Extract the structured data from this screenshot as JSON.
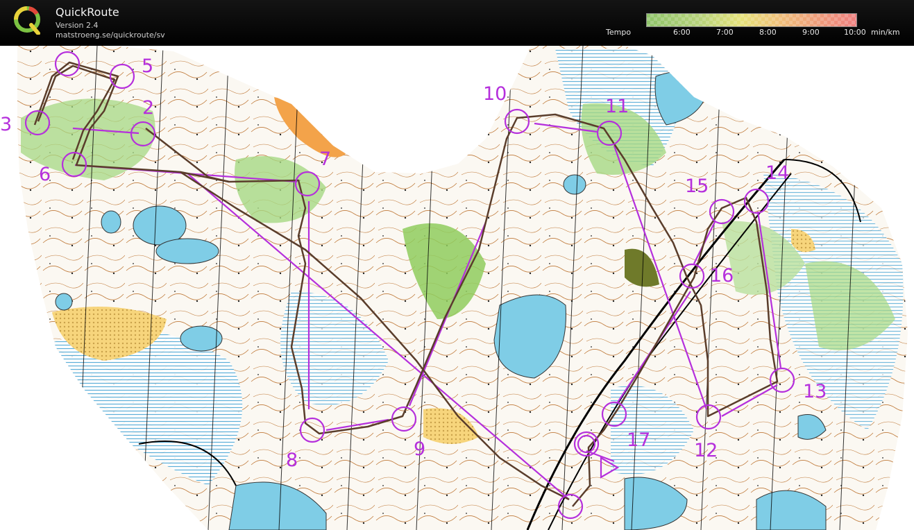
{
  "app": {
    "title": "QuickRoute",
    "version": "Version 2.4",
    "url": "matstroeng.se/quickroute/sv"
  },
  "legend": {
    "label": "Tempo",
    "ticks": [
      "6:00",
      "7:00",
      "8:00",
      "9:00",
      "10:00"
    ],
    "unit": "min/km"
  },
  "map": {
    "course_color": "#b52fdc",
    "route_color": "#5a3d2b",
    "controls": [
      {
        "label": "2"
      },
      {
        "label": "3"
      },
      {
        "label": "5"
      },
      {
        "label": "6"
      },
      {
        "label": "7"
      },
      {
        "label": "8"
      },
      {
        "label": "9"
      },
      {
        "label": "10"
      },
      {
        "label": "11"
      },
      {
        "label": "12"
      },
      {
        "label": "13"
      },
      {
        "label": "14"
      },
      {
        "label": "15"
      },
      {
        "label": "16"
      },
      {
        "label": "17"
      }
    ]
  }
}
